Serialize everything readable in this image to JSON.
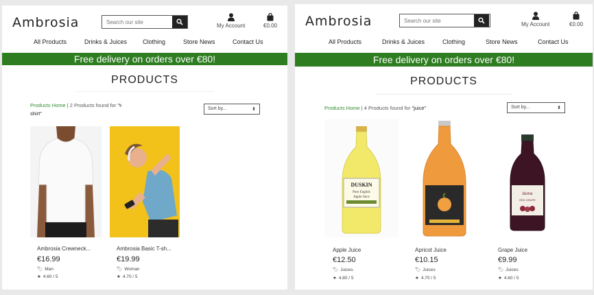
{
  "site": {
    "brand": "Ambrosia",
    "search_placeholder": "Search our site",
    "account_label": "My Account",
    "bag_total": "€0.00",
    "nav": [
      "All Products",
      "Drinks & Juices",
      "Clothing",
      "Store News",
      "Contact Us"
    ],
    "banner": "Free delivery on orders over €80!",
    "heading": "PRODUCTS",
    "sort_label": "Sort by..."
  },
  "left": {
    "crumb_home": "Products Home",
    "crumb_sep": " | 2 Products found for ",
    "crumb_query": "\"t-shirt\"",
    "products": [
      {
        "name": "Ambrosia Crewneck...",
        "price": "€16.99",
        "category": "Man",
        "rating": "4.60 / 5"
      },
      {
        "name": "Ambrosia Basic T-sh...",
        "price": "€19.99",
        "category": "Woman",
        "rating": "4.70 / 5"
      }
    ]
  },
  "right": {
    "crumb_home": "Products Home",
    "crumb_sep": " | 4 Products found for ",
    "crumb_query": "\"juice\"",
    "products": [
      {
        "name": "Apple Juice",
        "price": "€12.50",
        "category": "Juices",
        "rating": "4.80 / 5",
        "label_line1": "DUSKIN",
        "label_line2": "Pure English",
        "label_line3": "Apple Juice"
      },
      {
        "name": "Apricot Juice",
        "price": "€10.15",
        "category": "Juices",
        "rating": "4.70 / 5"
      },
      {
        "name": "Grape Juice",
        "price": "€9.99",
        "category": "Juices",
        "rating": "4.60 / 5",
        "label_line1": "biona",
        "label_line2": "RED GRAPE"
      }
    ]
  },
  "colors": {
    "banner": "#2e7d21",
    "link": "#2e8b2e",
    "dark": "#222222"
  }
}
